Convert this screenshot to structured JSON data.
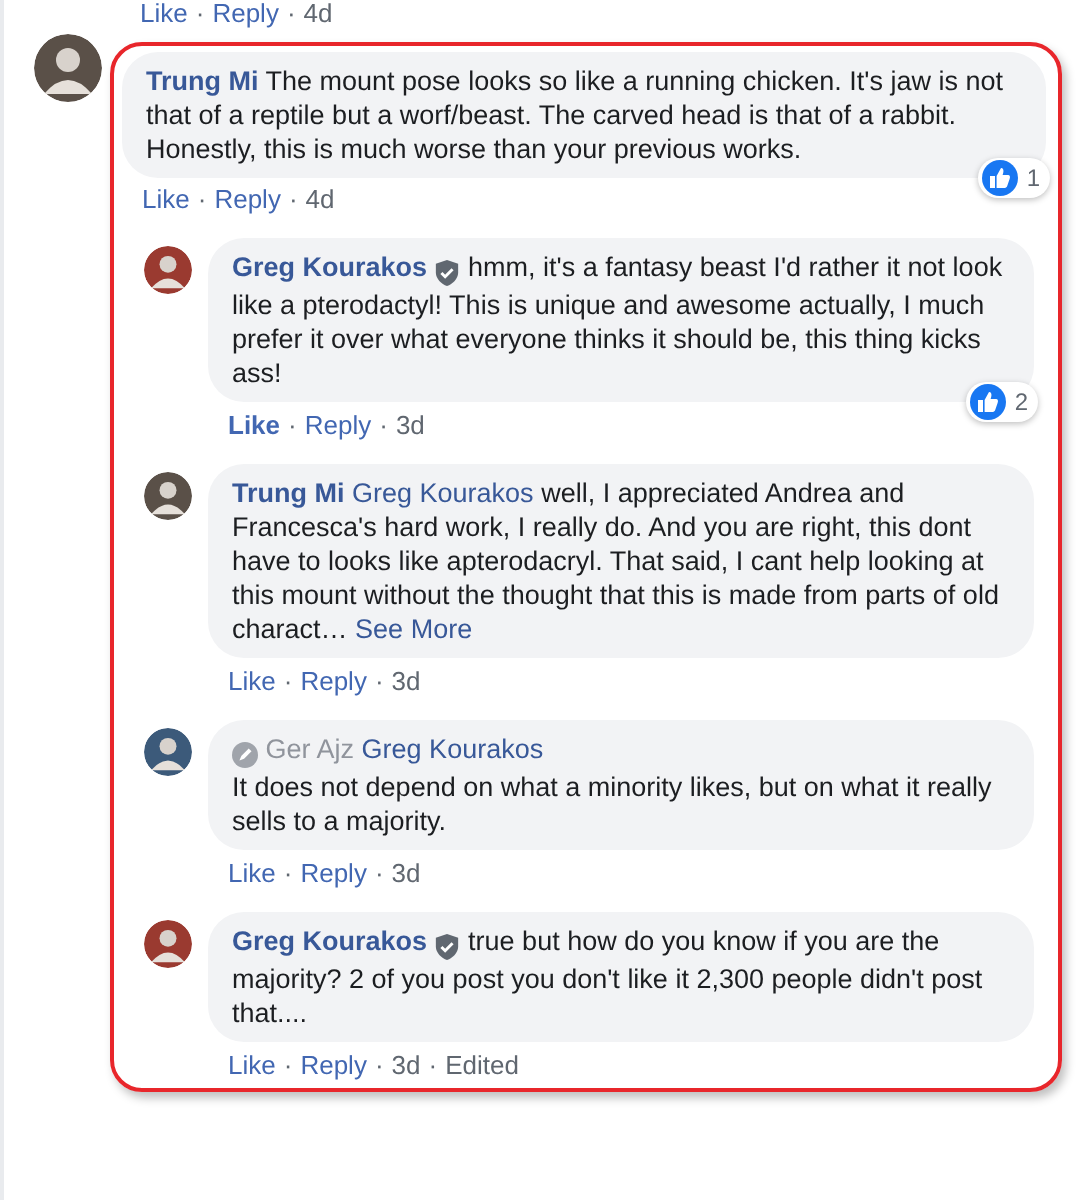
{
  "previous_actions": {
    "like": "Like",
    "reply": "Reply",
    "time": "4d",
    "separator": "·"
  },
  "comment": {
    "author": "Trung Mi",
    "verified": false,
    "author_muted": false,
    "text": "The mount pose looks so like a running chicken. It's jaw is not that of a reptile but a worf/beast. The carved head is that of a rabbit.\nHonestly, this is much worse than your previous works.",
    "like": "Like",
    "liked": false,
    "reply": "Reply",
    "time": "4d",
    "separator": "·",
    "reactions": "1",
    "replies": [
      {
        "author": "Greg Kourakos",
        "verified": true,
        "author_muted": false,
        "text": "hmm, it's a fantasy beast I'd rather it not look like a pterodactyl! This is unique and awesome actually, I much prefer it over what everyone thinks it should be, this thing kicks ass!",
        "like": "Like",
        "liked": true,
        "reply": "Reply",
        "time": "3d",
        "separator": "·",
        "reactions": "2"
      },
      {
        "author": "Trung Mi",
        "verified": false,
        "author_muted": false,
        "mention": "Greg Kourakos",
        "text": "well, I appreciated Andrea and Francesca's hard work, I really do. And you are right, this dont have to looks like apterodacryl. That said, I cant help looking at this mount without the thought that this is made from parts of old charact…",
        "see_more": "See More",
        "like": "Like",
        "liked": false,
        "reply": "Reply",
        "time": "3d",
        "separator": "·"
      },
      {
        "author": "Ger Ajz",
        "verified": false,
        "author_muted": true,
        "mention": "Greg Kourakos",
        "text": "\nIt does not depend on what a minority likes, but on what it really sells to a majority.",
        "like": "Like",
        "liked": false,
        "reply": "Reply",
        "time": "3d",
        "separator": "·"
      },
      {
        "author": "Greg Kourakos",
        "verified": true,
        "author_muted": false,
        "text": "true but how do you know if you are the majority? 2 of you post you don't like it 2,300 people didn't post that....",
        "like": "Like",
        "liked": false,
        "reply": "Reply",
        "time": "3d",
        "separator": "·",
        "edited": "Edited"
      }
    ]
  }
}
